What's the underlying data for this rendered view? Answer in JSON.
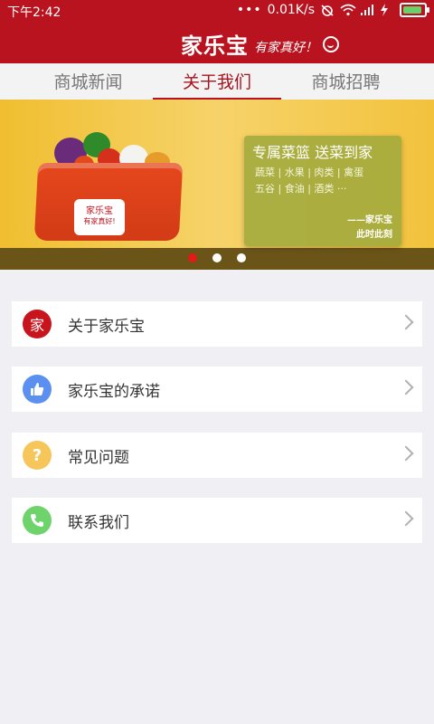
{
  "status": {
    "time": "下午2:42",
    "network": "0.01K/s"
  },
  "header": {
    "brand": "家乐宝",
    "slogan": "有家真好！",
    "brand_color": "#b8131f"
  },
  "tabs": [
    {
      "label": "商城新闻",
      "active": false
    },
    {
      "label": "关于我们",
      "active": true
    },
    {
      "label": "商城招聘",
      "active": false
    }
  ],
  "banner": {
    "promo_title": "专属菜篮 送菜到家",
    "promo_line1": "蔬菜 | 水果 | 肉类 | 禽蛋",
    "promo_line2": "五谷 | 食油 | 酒类 ···",
    "sign1": "——家乐宝",
    "sign2": "此时此刻",
    "basket_label": "家乐宝",
    "basket_sub": "有家真好!",
    "dots": 3,
    "active_dot": 0
  },
  "menu": [
    {
      "label": "关于家乐宝",
      "icon": "home-logo-icon",
      "icon_text": "家",
      "color": "#c8141d"
    },
    {
      "label": "家乐宝的承诺",
      "icon": "thumbs-up-icon",
      "icon_text": "👍",
      "color": "#5b8ff0"
    },
    {
      "label": "常见问题",
      "icon": "question-icon",
      "icon_text": "?",
      "color": "#f6c65a"
    },
    {
      "label": "联系我们",
      "icon": "phone-icon",
      "icon_text": "✆",
      "color": "#6fd36b"
    }
  ]
}
